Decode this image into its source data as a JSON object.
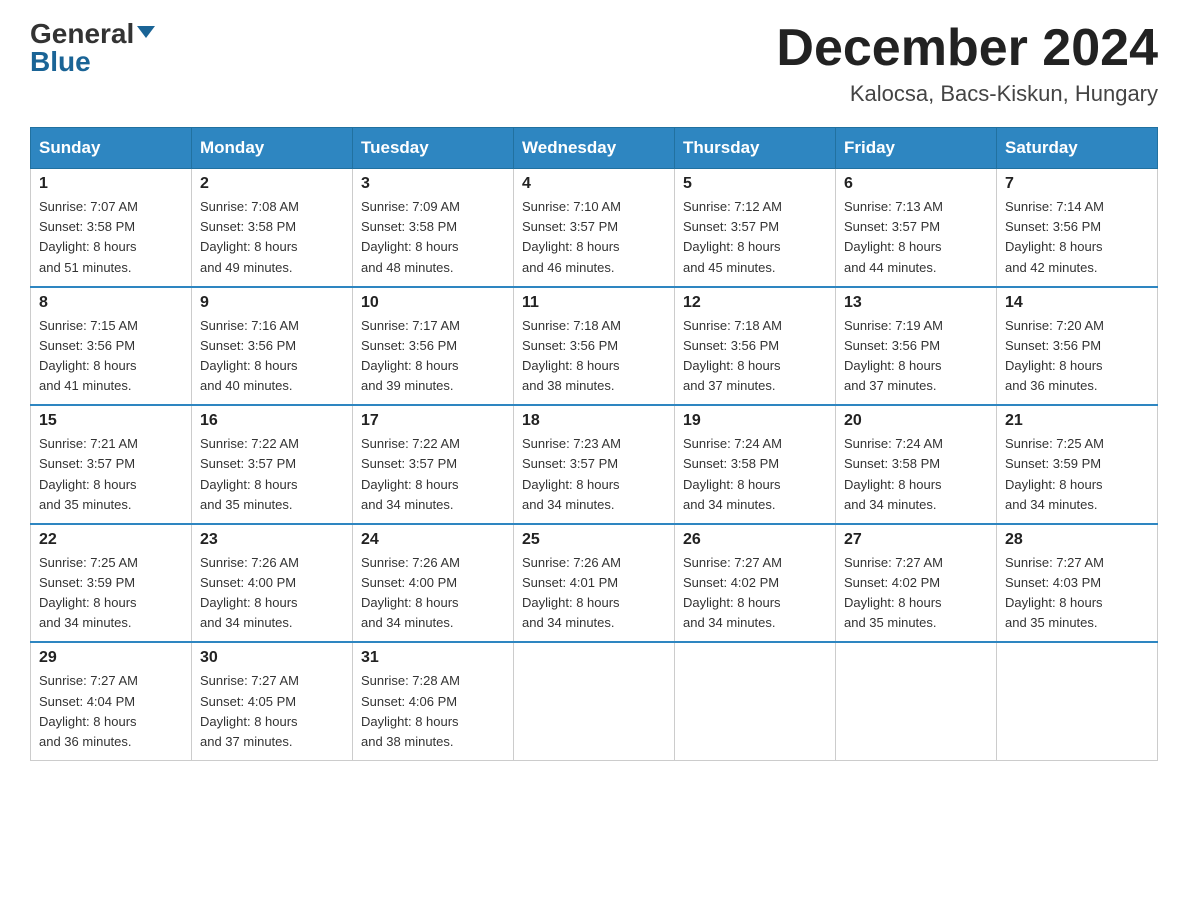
{
  "logo": {
    "general": "General",
    "arrow": "▼",
    "blue": "Blue"
  },
  "header": {
    "month_year": "December 2024",
    "location": "Kalocsa, Bacs-Kiskun, Hungary"
  },
  "weekdays": [
    "Sunday",
    "Monday",
    "Tuesday",
    "Wednesday",
    "Thursday",
    "Friday",
    "Saturday"
  ],
  "weeks": [
    [
      {
        "day": "1",
        "sunrise": "7:07 AM",
        "sunset": "3:58 PM",
        "daylight": "8 hours and 51 minutes."
      },
      {
        "day": "2",
        "sunrise": "7:08 AM",
        "sunset": "3:58 PM",
        "daylight": "8 hours and 49 minutes."
      },
      {
        "day": "3",
        "sunrise": "7:09 AM",
        "sunset": "3:58 PM",
        "daylight": "8 hours and 48 minutes."
      },
      {
        "day": "4",
        "sunrise": "7:10 AM",
        "sunset": "3:57 PM",
        "daylight": "8 hours and 46 minutes."
      },
      {
        "day": "5",
        "sunrise": "7:12 AM",
        "sunset": "3:57 PM",
        "daylight": "8 hours and 45 minutes."
      },
      {
        "day": "6",
        "sunrise": "7:13 AM",
        "sunset": "3:57 PM",
        "daylight": "8 hours and 44 minutes."
      },
      {
        "day": "7",
        "sunrise": "7:14 AM",
        "sunset": "3:56 PM",
        "daylight": "8 hours and 42 minutes."
      }
    ],
    [
      {
        "day": "8",
        "sunrise": "7:15 AM",
        "sunset": "3:56 PM",
        "daylight": "8 hours and 41 minutes."
      },
      {
        "day": "9",
        "sunrise": "7:16 AM",
        "sunset": "3:56 PM",
        "daylight": "8 hours and 40 minutes."
      },
      {
        "day": "10",
        "sunrise": "7:17 AM",
        "sunset": "3:56 PM",
        "daylight": "8 hours and 39 minutes."
      },
      {
        "day": "11",
        "sunrise": "7:18 AM",
        "sunset": "3:56 PM",
        "daylight": "8 hours and 38 minutes."
      },
      {
        "day": "12",
        "sunrise": "7:18 AM",
        "sunset": "3:56 PM",
        "daylight": "8 hours and 37 minutes."
      },
      {
        "day": "13",
        "sunrise": "7:19 AM",
        "sunset": "3:56 PM",
        "daylight": "8 hours and 37 minutes."
      },
      {
        "day": "14",
        "sunrise": "7:20 AM",
        "sunset": "3:56 PM",
        "daylight": "8 hours and 36 minutes."
      }
    ],
    [
      {
        "day": "15",
        "sunrise": "7:21 AM",
        "sunset": "3:57 PM",
        "daylight": "8 hours and 35 minutes."
      },
      {
        "day": "16",
        "sunrise": "7:22 AM",
        "sunset": "3:57 PM",
        "daylight": "8 hours and 35 minutes."
      },
      {
        "day": "17",
        "sunrise": "7:22 AM",
        "sunset": "3:57 PM",
        "daylight": "8 hours and 34 minutes."
      },
      {
        "day": "18",
        "sunrise": "7:23 AM",
        "sunset": "3:57 PM",
        "daylight": "8 hours and 34 minutes."
      },
      {
        "day": "19",
        "sunrise": "7:24 AM",
        "sunset": "3:58 PM",
        "daylight": "8 hours and 34 minutes."
      },
      {
        "day": "20",
        "sunrise": "7:24 AM",
        "sunset": "3:58 PM",
        "daylight": "8 hours and 34 minutes."
      },
      {
        "day": "21",
        "sunrise": "7:25 AM",
        "sunset": "3:59 PM",
        "daylight": "8 hours and 34 minutes."
      }
    ],
    [
      {
        "day": "22",
        "sunrise": "7:25 AM",
        "sunset": "3:59 PM",
        "daylight": "8 hours and 34 minutes."
      },
      {
        "day": "23",
        "sunrise": "7:26 AM",
        "sunset": "4:00 PM",
        "daylight": "8 hours and 34 minutes."
      },
      {
        "day": "24",
        "sunrise": "7:26 AM",
        "sunset": "4:00 PM",
        "daylight": "8 hours and 34 minutes."
      },
      {
        "day": "25",
        "sunrise": "7:26 AM",
        "sunset": "4:01 PM",
        "daylight": "8 hours and 34 minutes."
      },
      {
        "day": "26",
        "sunrise": "7:27 AM",
        "sunset": "4:02 PM",
        "daylight": "8 hours and 34 minutes."
      },
      {
        "day": "27",
        "sunrise": "7:27 AM",
        "sunset": "4:02 PM",
        "daylight": "8 hours and 35 minutes."
      },
      {
        "day": "28",
        "sunrise": "7:27 AM",
        "sunset": "4:03 PM",
        "daylight": "8 hours and 35 minutes."
      }
    ],
    [
      {
        "day": "29",
        "sunrise": "7:27 AM",
        "sunset": "4:04 PM",
        "daylight": "8 hours and 36 minutes."
      },
      {
        "day": "30",
        "sunrise": "7:27 AM",
        "sunset": "4:05 PM",
        "daylight": "8 hours and 37 minutes."
      },
      {
        "day": "31",
        "sunrise": "7:28 AM",
        "sunset": "4:06 PM",
        "daylight": "8 hours and 38 minutes."
      },
      null,
      null,
      null,
      null
    ]
  ],
  "labels": {
    "sunrise": "Sunrise:",
    "sunset": "Sunset:",
    "daylight": "Daylight:"
  }
}
